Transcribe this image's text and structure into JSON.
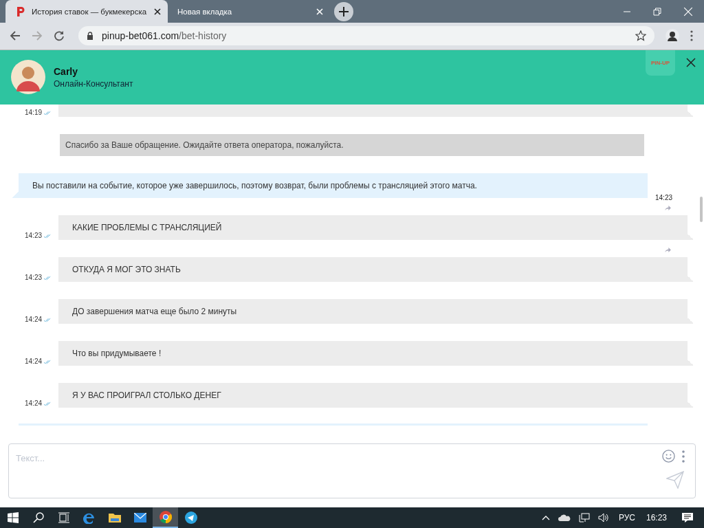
{
  "browser": {
    "tabs": [
      {
        "title": "История ставок — букмекерска",
        "selected": true,
        "kind": "site"
      },
      {
        "title": "Новая вкладка",
        "selected": false,
        "kind": "blank"
      }
    ],
    "url": {
      "host": "pinup-bet061.com",
      "path": "/bet-history"
    }
  },
  "chat_header": {
    "name": "Carly",
    "role": "Онлайн-Консультант",
    "logo": "PIN-UP"
  },
  "messages": [
    {
      "kind": "user",
      "time": "14:19",
      "partial": true,
      "forward": false
    },
    {
      "kind": "system",
      "text": "Спасибо за Ваше обращение. Ожидайте ответа оператора, пожалуйста."
    },
    {
      "kind": "operator",
      "text": "Вы поставили на событие, которое уже завершилось, поэтому возврат, были проблемы с трансляцией этого матча.",
      "time": "14:23"
    },
    {
      "kind": "user",
      "text": "КАКИЕ ПРОБЛЕМЫ С ТРАНСЛЯЦИЕЙ",
      "time": "14:23",
      "forward": true
    },
    {
      "kind": "user",
      "text": "ОТКУДА Я МОГ ЭТО ЗНАТЬ",
      "time": "14:23",
      "forward": true
    },
    {
      "kind": "user",
      "text": "ДО завершения матча еще было 2 минуты",
      "time": "14:24",
      "forward": false
    },
    {
      "kind": "user",
      "text": "Что вы придумываете !",
      "time": "14:24",
      "forward": false
    },
    {
      "kind": "user",
      "text": "Я У ВАС ПРОИГРАЛ СТОЛЬКО ДЕНЕГ",
      "time": "14:24",
      "forward": false
    },
    {
      "kind": "operator",
      "partial": true
    }
  ],
  "composer": {
    "placeholder": "Текст..."
  },
  "taskbar": {
    "apps": [
      {
        "kind": "start",
        "selected": false
      },
      {
        "kind": "search",
        "selected": false
      },
      {
        "kind": "taskview",
        "selected": false
      },
      {
        "kind": "edge",
        "selected": false
      },
      {
        "kind": "folder",
        "selected": false
      },
      {
        "kind": "mail",
        "selected": false
      },
      {
        "kind": "chrome",
        "selected": true
      },
      {
        "kind": "telegram",
        "selected": false
      }
    ],
    "language": "РУС",
    "clock": "16:23"
  }
}
